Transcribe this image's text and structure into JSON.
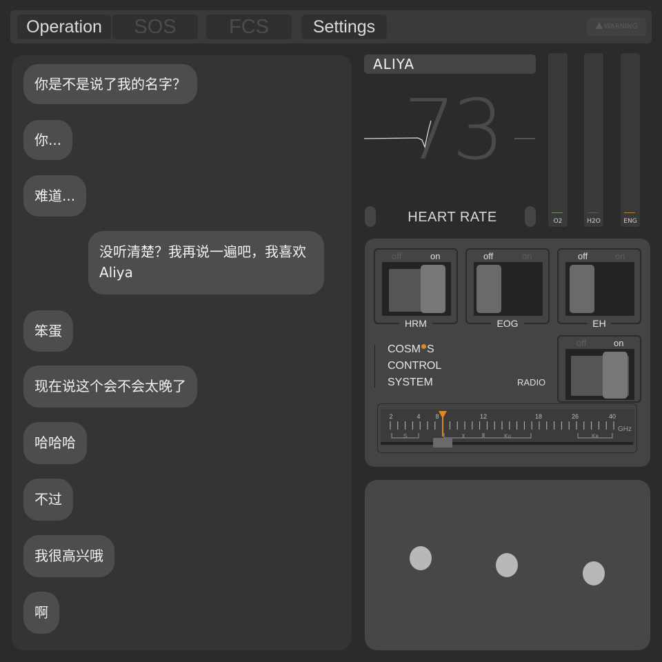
{
  "tabs": [
    {
      "label": "Operation"
    },
    {
      "label": "SOS"
    },
    {
      "label": "FCS"
    },
    {
      "label": "Settings"
    }
  ],
  "warning_label": "WARNING",
  "chat": {
    "messages": [
      {
        "text": "你是不是说了我的名字？",
        "side": "left"
      },
      {
        "text": "你...",
        "side": "left"
      },
      {
        "text": "难道...",
        "side": "left"
      },
      {
        "text": "没听清楚？我再说一遍吧，我喜欢Aliya",
        "side": "right"
      },
      {
        "text": "笨蛋",
        "side": "left"
      },
      {
        "text": "现在说这个会不会太晚了",
        "side": "left"
      },
      {
        "text": "哈哈哈",
        "side": "left"
      },
      {
        "text": "不过",
        "side": "left"
      },
      {
        "text": "我很高兴哦",
        "side": "left"
      },
      {
        "text": "啊",
        "side": "left"
      }
    ]
  },
  "vitals": {
    "name": "ALIYA",
    "heart_rate": "73",
    "heart_rate_label": "HEART RATE",
    "gauges": [
      {
        "label": "O2",
        "color": "#6f8a5e"
      },
      {
        "label": "H2O",
        "color": "#5a5a5a"
      },
      {
        "label": "ENG",
        "color": "#b8862a"
      }
    ]
  },
  "controls": {
    "switches": [
      {
        "label": "HRM",
        "off": "off",
        "on": "on",
        "state": "on"
      },
      {
        "label": "EOG",
        "off": "off",
        "on": "on",
        "state": "off"
      },
      {
        "label": "EH",
        "off": "off",
        "on": "on",
        "state": "off"
      }
    ],
    "system_lines": [
      "COSM",
      "S",
      "CONTROL",
      "SYSTEM"
    ],
    "radio": {
      "label": "RADIO",
      "off": "off",
      "on": "on",
      "state": "on"
    },
    "tuner": {
      "ticks": [
        "2",
        "4",
        "8",
        "12",
        "18",
        "26",
        "40"
      ],
      "bands": [
        "S",
        "X",
        "Ku",
        "Ka"
      ],
      "unit": "GHz",
      "selected_ghz": 8
    }
  },
  "colors": {
    "accent": "#e08a1e",
    "panel": "#343434",
    "bubble": "#4d4d4d"
  }
}
